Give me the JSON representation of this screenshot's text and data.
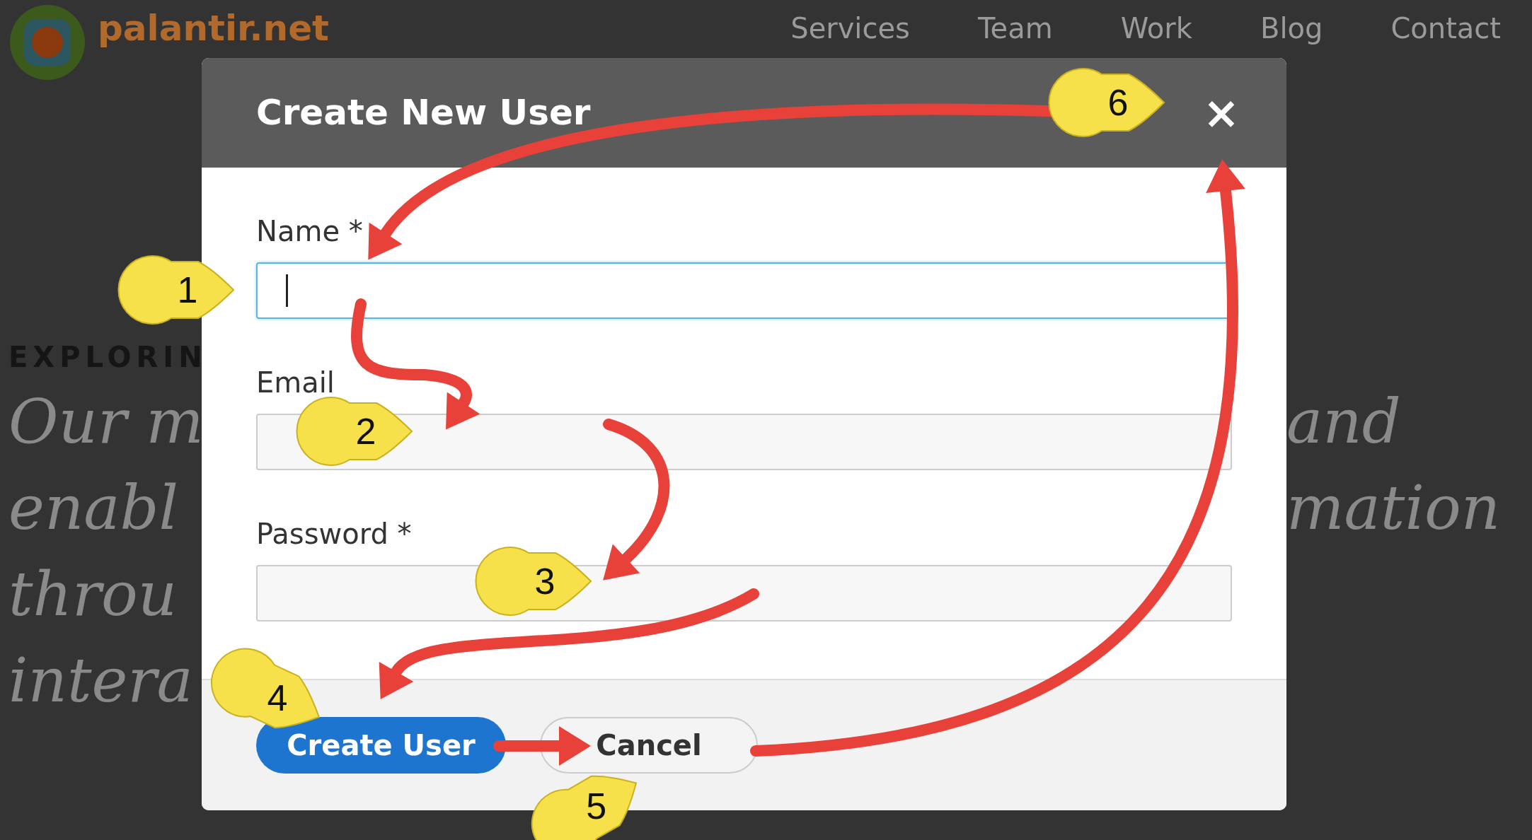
{
  "site": {
    "logo_text": "palantir.net",
    "nav": [
      "Services",
      "Team",
      "Work",
      "Blog",
      "Contact"
    ]
  },
  "page": {
    "eyebrow": "EXPLORIN",
    "left_lines": [
      "Our m",
      "enabl",
      "throu",
      "intera"
    ],
    "right_lines": [
      "and",
      "mation"
    ]
  },
  "modal": {
    "title": "Create New User",
    "close": "×",
    "fields": [
      {
        "label": "Name *",
        "focused": true
      },
      {
        "label": "Email",
        "focused": false
      },
      {
        "label": "Password *",
        "focused": false
      }
    ],
    "buttons": [
      {
        "label": "Create User",
        "kind": "primary"
      },
      {
        "label": "Cancel",
        "kind": "secondary"
      }
    ]
  },
  "annotations": {
    "callouts": [
      "1",
      "2",
      "3",
      "4",
      "5",
      "6"
    ]
  }
}
